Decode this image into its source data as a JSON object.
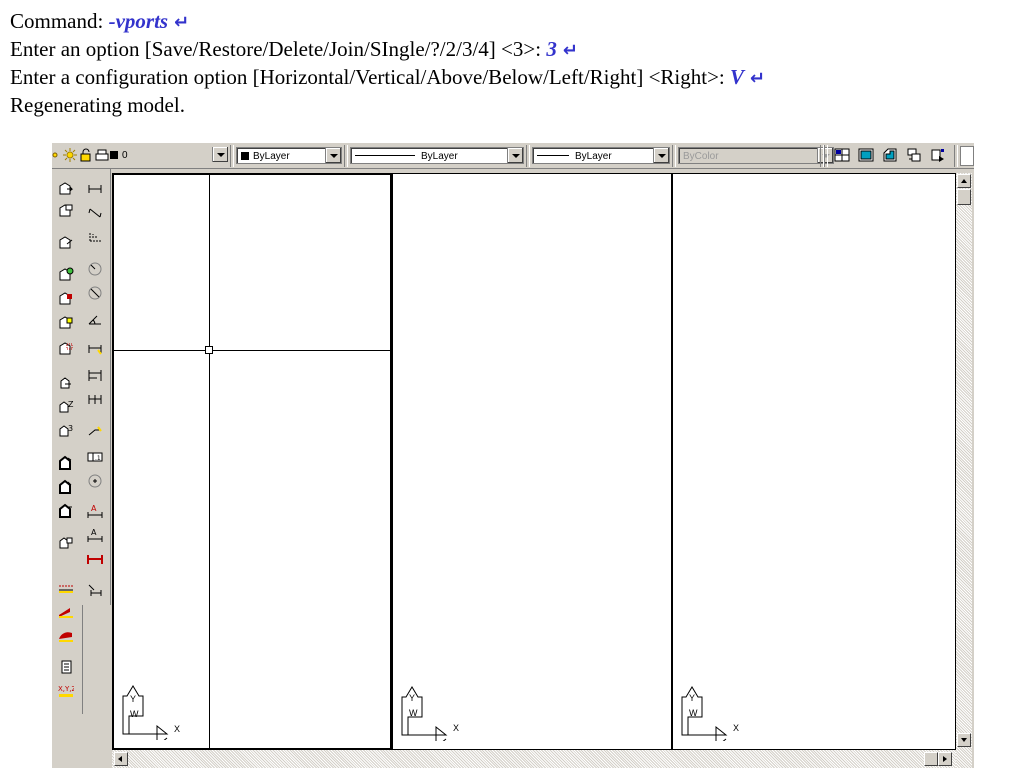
{
  "command_lines": [
    {
      "text": "Command: ",
      "input": "-vports"
    },
    {
      "text": "Enter an option [Save/Restore/Delete/Join/SIngle/?/2/3/4] <3>: ",
      "input": "3"
    },
    {
      "text": "Enter a configuration option [Horizontal/Vertical/Above/Below/Left/Right] <Right>: ",
      "input": "V"
    },
    {
      "text": "Regenerating model.",
      "input": ""
    }
  ],
  "enter_symbol": "↵",
  "toolbar": {
    "layer_value": "0",
    "color_value": "ByLayer",
    "linetype_value": "ByLayer",
    "lineweight_value": "ByLayer",
    "plotstyle_value": "ByColor"
  },
  "ucs_labels": {
    "y": "Y",
    "x": "X",
    "w": "W"
  },
  "colors": {
    "input": "#3333cc",
    "chrome": "#d4d0c8",
    "canvas": "#ffffff"
  },
  "viewports": {
    "count": 3,
    "configuration": "Vertical",
    "active": 1
  },
  "icons": {
    "toolbar": [
      "layer-state-icons",
      "viewport-dialog-icon",
      "single-viewport-icon",
      "clip-viewport-icon",
      "polygonal-viewport-icon",
      "viewport-scale-icon"
    ],
    "left_toolbar": [
      "view-front-icon",
      "view-top-icon",
      "view-iso-icon",
      "render-icon",
      "shade-icon",
      "material-icon",
      "region-icon",
      "ucs-icon",
      "ucs-z-icon",
      "ucs-3point-icon",
      "rotate-x-icon",
      "rotate-y-icon",
      "rotate-z-icon",
      "apply-ucs-icon",
      "linetype-icon",
      "thickness-icon",
      "elevation-icon",
      "properties-icon",
      "xyz-filter-icon"
    ],
    "dim_toolbar": [
      "linear-dim-icon",
      "aligned-dim-icon",
      "ordinate-dim-icon",
      "radius-dim-icon",
      "diameter-dim-icon",
      "angular-dim-icon",
      "quick-dim-icon",
      "baseline-dim-icon",
      "continue-dim-icon",
      "leader-icon",
      "tolerance-icon",
      "center-mark-icon",
      "dim-edit-icon",
      "dim-text-edit-icon",
      "dim-update-icon",
      "dim-style-icon"
    ]
  }
}
